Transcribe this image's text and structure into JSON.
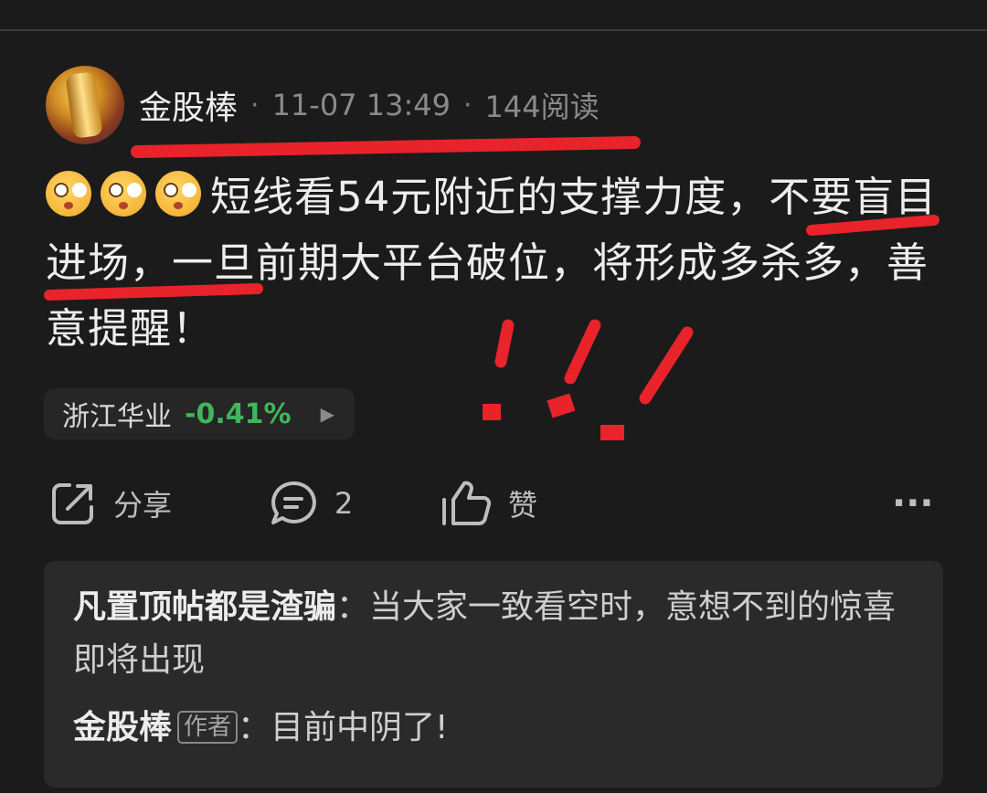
{
  "header": {
    "author": "金股棒",
    "separator": "·",
    "datetime": "11-07 13:49",
    "reads": "144阅读"
  },
  "post": {
    "emojis": [
      "flushed-face-emoji",
      "flushed-face-emoji",
      "flushed-face-emoji"
    ],
    "text": "短线看54元附近的支撑力度，不要盲目进场，一旦前期大平台破位，将形成多杀多，善意提醒！"
  },
  "stock": {
    "name": "浙江华业",
    "change": "-0.41%",
    "change_color": "#3fb65a"
  },
  "actions": {
    "share_label": "分享",
    "comment_count": "2",
    "like_label": "赞",
    "more_label": "···"
  },
  "comments": [
    {
      "user": "凡置顶帖都是渣骗",
      "colon": "：",
      "text": "当大家一致看空时，意想不到的惊喜即将出现"
    },
    {
      "user": "金股棒",
      "badge": "作者",
      "colon": "：",
      "text": "目前中阴了!"
    }
  ],
  "annotation_color": "#e8232a"
}
